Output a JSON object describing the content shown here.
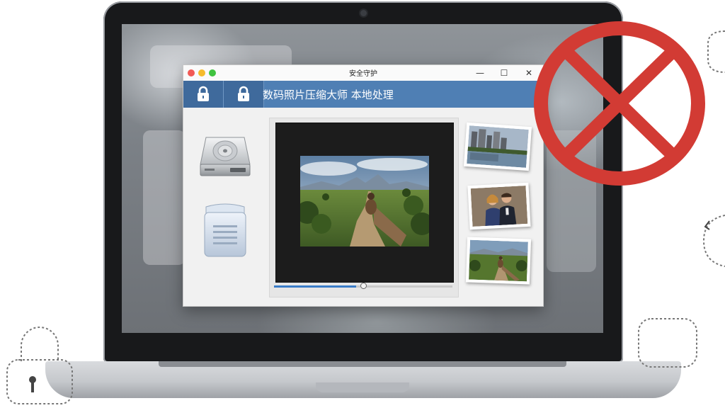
{
  "window": {
    "title": "安全守护",
    "controls": {
      "minimize": "—",
      "maximize": "☐",
      "close": "✕"
    }
  },
  "header": {
    "title": "数码照片压缩大师 本地处理"
  },
  "icons": {
    "header_left": [
      "lock-icon",
      "lock-icon"
    ],
    "sidebar": [
      "hard-drive-icon",
      "document-storage-icon"
    ],
    "overlay": "prohibited-sign-icon",
    "doodles": [
      "padlock-outline-icon",
      "rounded-square-outline-icon",
      "cursor-outline-icon"
    ]
  },
  "viewer": {
    "progress": 0.46
  },
  "thumbnails": [
    {
      "subject": "city-lake"
    },
    {
      "subject": "couple-portrait"
    },
    {
      "subject": "person-on-path"
    }
  ],
  "colors": {
    "header_band": "#4f7fb4",
    "lock_tab": "#3f6a9c",
    "progress": "#3a7cc7",
    "prohibit_red": "#d23b34"
  }
}
